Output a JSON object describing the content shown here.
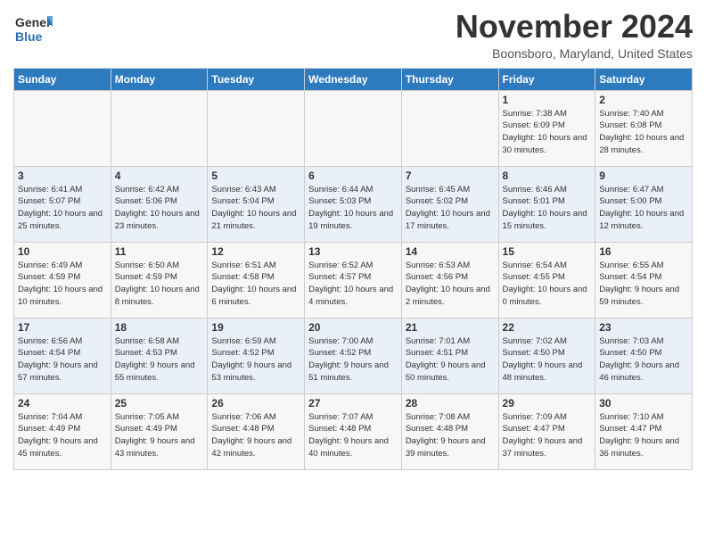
{
  "logo": {
    "general": "General",
    "blue": "Blue"
  },
  "title": "November 2024",
  "location": "Boonsboro, Maryland, United States",
  "days_of_week": [
    "Sunday",
    "Monday",
    "Tuesday",
    "Wednesday",
    "Thursday",
    "Friday",
    "Saturday"
  ],
  "weeks": [
    [
      {
        "day": "",
        "info": ""
      },
      {
        "day": "",
        "info": ""
      },
      {
        "day": "",
        "info": ""
      },
      {
        "day": "",
        "info": ""
      },
      {
        "day": "",
        "info": ""
      },
      {
        "day": "1",
        "info": "Sunrise: 7:38 AM\nSunset: 6:09 PM\nDaylight: 10 hours and 30 minutes."
      },
      {
        "day": "2",
        "info": "Sunrise: 7:40 AM\nSunset: 6:08 PM\nDaylight: 10 hours and 28 minutes."
      }
    ],
    [
      {
        "day": "3",
        "info": "Sunrise: 6:41 AM\nSunset: 5:07 PM\nDaylight: 10 hours and 25 minutes."
      },
      {
        "day": "4",
        "info": "Sunrise: 6:42 AM\nSunset: 5:06 PM\nDaylight: 10 hours and 23 minutes."
      },
      {
        "day": "5",
        "info": "Sunrise: 6:43 AM\nSunset: 5:04 PM\nDaylight: 10 hours and 21 minutes."
      },
      {
        "day": "6",
        "info": "Sunrise: 6:44 AM\nSunset: 5:03 PM\nDaylight: 10 hours and 19 minutes."
      },
      {
        "day": "7",
        "info": "Sunrise: 6:45 AM\nSunset: 5:02 PM\nDaylight: 10 hours and 17 minutes."
      },
      {
        "day": "8",
        "info": "Sunrise: 6:46 AM\nSunset: 5:01 PM\nDaylight: 10 hours and 15 minutes."
      },
      {
        "day": "9",
        "info": "Sunrise: 6:47 AM\nSunset: 5:00 PM\nDaylight: 10 hours and 12 minutes."
      }
    ],
    [
      {
        "day": "10",
        "info": "Sunrise: 6:49 AM\nSunset: 4:59 PM\nDaylight: 10 hours and 10 minutes."
      },
      {
        "day": "11",
        "info": "Sunrise: 6:50 AM\nSunset: 4:59 PM\nDaylight: 10 hours and 8 minutes."
      },
      {
        "day": "12",
        "info": "Sunrise: 6:51 AM\nSunset: 4:58 PM\nDaylight: 10 hours and 6 minutes."
      },
      {
        "day": "13",
        "info": "Sunrise: 6:52 AM\nSunset: 4:57 PM\nDaylight: 10 hours and 4 minutes."
      },
      {
        "day": "14",
        "info": "Sunrise: 6:53 AM\nSunset: 4:56 PM\nDaylight: 10 hours and 2 minutes."
      },
      {
        "day": "15",
        "info": "Sunrise: 6:54 AM\nSunset: 4:55 PM\nDaylight: 10 hours and 0 minutes."
      },
      {
        "day": "16",
        "info": "Sunrise: 6:55 AM\nSunset: 4:54 PM\nDaylight: 9 hours and 59 minutes."
      }
    ],
    [
      {
        "day": "17",
        "info": "Sunrise: 6:56 AM\nSunset: 4:54 PM\nDaylight: 9 hours and 57 minutes."
      },
      {
        "day": "18",
        "info": "Sunrise: 6:58 AM\nSunset: 4:53 PM\nDaylight: 9 hours and 55 minutes."
      },
      {
        "day": "19",
        "info": "Sunrise: 6:59 AM\nSunset: 4:52 PM\nDaylight: 9 hours and 53 minutes."
      },
      {
        "day": "20",
        "info": "Sunrise: 7:00 AM\nSunset: 4:52 PM\nDaylight: 9 hours and 51 minutes."
      },
      {
        "day": "21",
        "info": "Sunrise: 7:01 AM\nSunset: 4:51 PM\nDaylight: 9 hours and 50 minutes."
      },
      {
        "day": "22",
        "info": "Sunrise: 7:02 AM\nSunset: 4:50 PM\nDaylight: 9 hours and 48 minutes."
      },
      {
        "day": "23",
        "info": "Sunrise: 7:03 AM\nSunset: 4:50 PM\nDaylight: 9 hours and 46 minutes."
      }
    ],
    [
      {
        "day": "24",
        "info": "Sunrise: 7:04 AM\nSunset: 4:49 PM\nDaylight: 9 hours and 45 minutes."
      },
      {
        "day": "25",
        "info": "Sunrise: 7:05 AM\nSunset: 4:49 PM\nDaylight: 9 hours and 43 minutes."
      },
      {
        "day": "26",
        "info": "Sunrise: 7:06 AM\nSunset: 4:48 PM\nDaylight: 9 hours and 42 minutes."
      },
      {
        "day": "27",
        "info": "Sunrise: 7:07 AM\nSunset: 4:48 PM\nDaylight: 9 hours and 40 minutes."
      },
      {
        "day": "28",
        "info": "Sunrise: 7:08 AM\nSunset: 4:48 PM\nDaylight: 9 hours and 39 minutes."
      },
      {
        "day": "29",
        "info": "Sunrise: 7:09 AM\nSunset: 4:47 PM\nDaylight: 9 hours and 37 minutes."
      },
      {
        "day": "30",
        "info": "Sunrise: 7:10 AM\nSunset: 4:47 PM\nDaylight: 9 hours and 36 minutes."
      }
    ]
  ]
}
